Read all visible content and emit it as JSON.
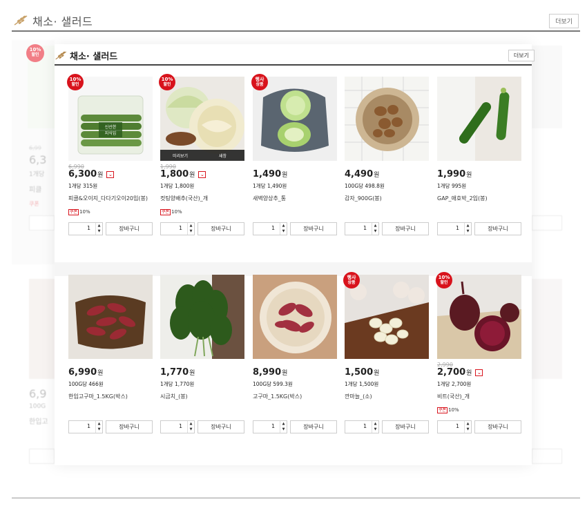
{
  "section": {
    "title": "채소· 샐러드",
    "more_label": "더보기"
  },
  "background": {
    "left_price_1": "6,3",
    "left_unit_1": "1개당",
    "left_name_1": "피클",
    "left_orig_1": "6,99",
    "left_coupon_1": "쿠폰",
    "left_price_2": "6,9",
    "left_unit_2": "100G",
    "left_name_2": "한입고",
    "badge": "10%",
    "badge_sub": "할인"
  },
  "panel": {
    "title": "채소· 샐러드",
    "more_label": "더보기",
    "cart_label": "장바구니",
    "overlay": {
      "preview": "미리보기",
      "new_window": "새창"
    },
    "rows": [
      [
        {
          "badge": "10%",
          "badge_sub": "할인",
          "orig": "6,990",
          "price": "6,300",
          "won": "원",
          "dropdown": true,
          "unit": "1개당 315원",
          "name": "피클&오이지_다다기오이20입(봉)",
          "coupon_tag": "쿠폰",
          "coupon": "10%",
          "qty": "1",
          "image": "cucumber-bag"
        },
        {
          "badge": "10%",
          "badge_sub": "할인",
          "orig": "1,990",
          "price": "1,800",
          "won": "원",
          "dropdown": true,
          "unit": "1개당 1,800원",
          "name": "컷팅양배추(국산)_개",
          "coupon_tag": "쿠폰",
          "coupon": "10%",
          "qty": "1",
          "image": "cabbage"
        },
        {
          "badge": "행사",
          "badge_sub": "상품",
          "orig": "",
          "price": "1,490",
          "won": "원",
          "dropdown": false,
          "unit": "1개당 1,490원",
          "name": "새벽양상추_통",
          "coupon_tag": "",
          "coupon": "",
          "qty": "1",
          "image": "lettuce"
        },
        {
          "badge": "",
          "badge_sub": "",
          "orig": "",
          "price": "4,490",
          "won": "원",
          "dropdown": false,
          "unit": "100G당 498.8원",
          "name": "감자_900G(봉)",
          "coupon_tag": "",
          "coupon": "",
          "qty": "1",
          "image": "potato"
        },
        {
          "badge": "",
          "badge_sub": "",
          "orig": "",
          "price": "1,990",
          "won": "원",
          "dropdown": false,
          "unit": "1개당 995원",
          "name": "GAP_애호박_2입(봉)",
          "coupon_tag": "",
          "coupon": "",
          "qty": "1",
          "image": "zucchini"
        }
      ],
      [
        {
          "badge": "",
          "badge_sub": "",
          "orig": "",
          "price": "6,990",
          "won": "원",
          "dropdown": false,
          "unit": "100G당 466원",
          "name": "한입고구마_1.5KG(박스)",
          "coupon_tag": "",
          "coupon": "",
          "qty": "1",
          "image": "sweet-potato-basket"
        },
        {
          "badge": "",
          "badge_sub": "",
          "orig": "",
          "price": "1,770",
          "won": "원",
          "dropdown": false,
          "unit": "1개당 1,770원",
          "name": "시금치_(봉)",
          "coupon_tag": "",
          "coupon": "",
          "qty": "1",
          "image": "spinach"
        },
        {
          "badge": "",
          "badge_sub": "",
          "orig": "",
          "price": "8,990",
          "won": "원",
          "dropdown": false,
          "unit": "100G당 599.3원",
          "name": "고구마_1.5KG(박스)",
          "coupon_tag": "",
          "coupon": "",
          "qty": "1",
          "image": "sweet-potato-bowl"
        },
        {
          "badge": "행사",
          "badge_sub": "상품",
          "orig": "",
          "price": "1,500",
          "won": "원",
          "dropdown": false,
          "unit": "1개당 1,500원",
          "name": "깐마늘_(소)",
          "coupon_tag": "",
          "coupon": "",
          "qty": "1",
          "image": "garlic"
        },
        {
          "badge": "10%",
          "badge_sub": "할인",
          "orig": "2,990",
          "price": "2,700",
          "won": "원",
          "dropdown": true,
          "unit": "1개당 2,700원",
          "name": "비트(국산)_개",
          "coupon_tag": "쿠폰",
          "coupon": "10%",
          "qty": "1",
          "image": "beet"
        }
      ]
    ]
  },
  "colors": {
    "accent": "#d8131c",
    "header_line": "#444444"
  }
}
